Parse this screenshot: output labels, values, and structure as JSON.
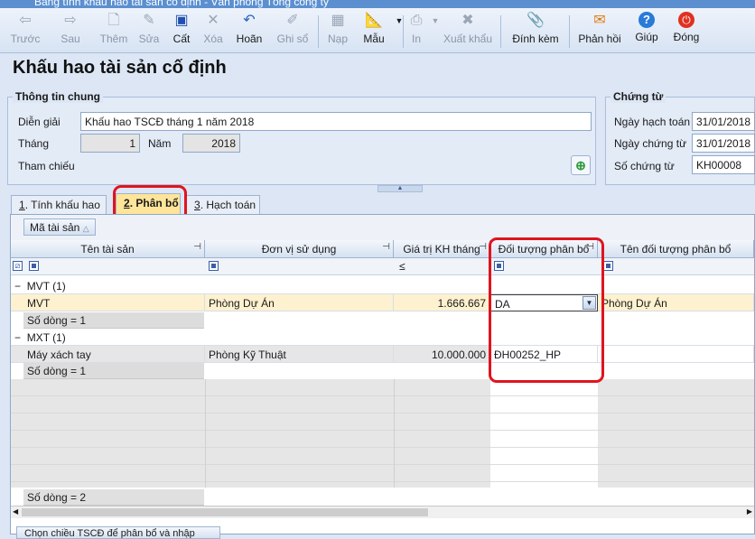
{
  "window": {
    "title": "Bảng tính khấu hao tài sản cố định - Văn phòng Tổng công ty"
  },
  "toolbar": {
    "back": "Trước",
    "next": "Sau",
    "add": "Thêm",
    "edit": "Sửa",
    "save": "Cất",
    "delete": "Xóa",
    "undo": "Hoãn",
    "post": "Ghi sổ",
    "load": "Nạp",
    "template": "Mẫu",
    "print": "In",
    "export": "Xuất khẩu",
    "attach": "Đính kèm",
    "feedback": "Phản hồi",
    "help": "Giúp",
    "close": "Đóng"
  },
  "page": {
    "title": "Khấu hao tài sản cố định"
  },
  "general": {
    "group_title": "Thông tin chung",
    "desc_label": "Diễn giải",
    "desc_value": "Khấu hao TSCĐ tháng 1 năm 2018",
    "month_label": "Tháng",
    "month_value": "1",
    "year_label": "Năm",
    "year_value": "2018",
    "ref_label": "Tham chiếu"
  },
  "voucher": {
    "group_title": "Chứng từ",
    "post_date_label": "Ngày hạch toán",
    "post_date": "31/01/2018",
    "voucher_date_label": "Ngày chứng từ",
    "voucher_date": "31/01/2018",
    "voucher_no_label": "Số chứng từ",
    "voucher_no": "KH00008"
  },
  "tabs": [
    {
      "num": "1",
      "label": ". Tính khấu hao"
    },
    {
      "num": "2",
      "label": ". Phân bổ"
    },
    {
      "num": "3",
      "label": ". Hạch toán"
    }
  ],
  "grid": {
    "group_by": "Mã tài sản",
    "columns": [
      "Tên tài sản",
      "Đơn vị sử dụng",
      "Giá trị KH tháng",
      "Đối tượng phân bổ",
      "Tên đối tượng phân bổ"
    ],
    "filter_op": "≤",
    "groups": [
      {
        "header": "MVT (1)",
        "row": {
          "name": "MVT",
          "unit": "Phòng Dự Án",
          "value": "1.666.667",
          "target": "DA",
          "target_name": "Phòng Dự Án"
        },
        "count": "Số dòng = 1"
      },
      {
        "header": "MXT (1)",
        "row": {
          "name": "Máy xách tay",
          "unit": "Phòng Kỹ Thuật",
          "value": "10.000.000",
          "target": "ĐH00252_HP",
          "target_name": ""
        },
        "count": "Số dòng = 1"
      }
    ],
    "total_count": "Số dòng = 2",
    "bottom_button": "Chọn chiều TSCĐ để phân bổ và nhập"
  }
}
